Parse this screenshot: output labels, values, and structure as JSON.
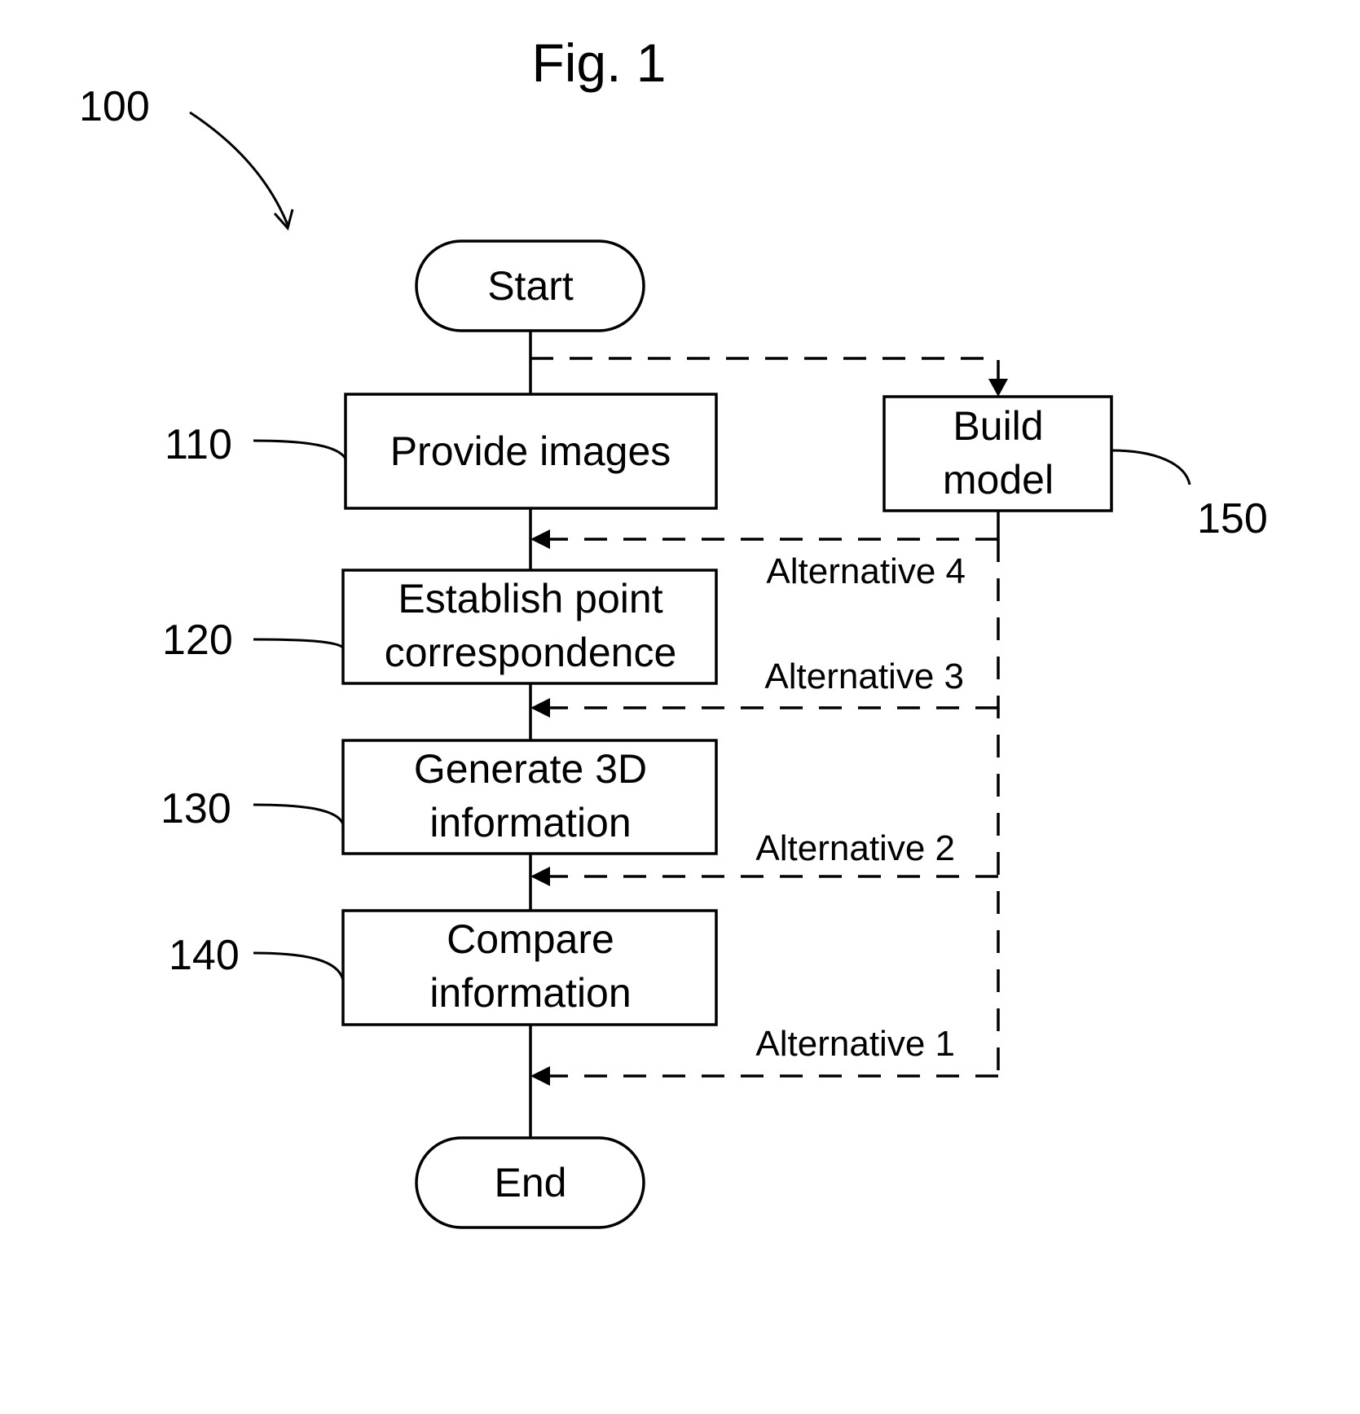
{
  "figure": {
    "title": "Fig. 1",
    "reference": "100"
  },
  "terminals": {
    "start": "Start",
    "end": "End"
  },
  "steps": [
    {
      "ref": "110",
      "lines": [
        "Provide images"
      ]
    },
    {
      "ref": "120",
      "lines": [
        "Establish point",
        "correspondence"
      ]
    },
    {
      "ref": "130",
      "lines": [
        "Generate 3D",
        "information"
      ]
    },
    {
      "ref": "140",
      "lines": [
        "Compare",
        "information"
      ]
    },
    {
      "ref": "150",
      "lines": [
        "Build",
        "model"
      ]
    }
  ],
  "alternatives": [
    "Alternative 4",
    "Alternative 3",
    "Alternative 2",
    "Alternative 1"
  ],
  "colors": {
    "ink": "#000000",
    "background": "#ffffff"
  }
}
